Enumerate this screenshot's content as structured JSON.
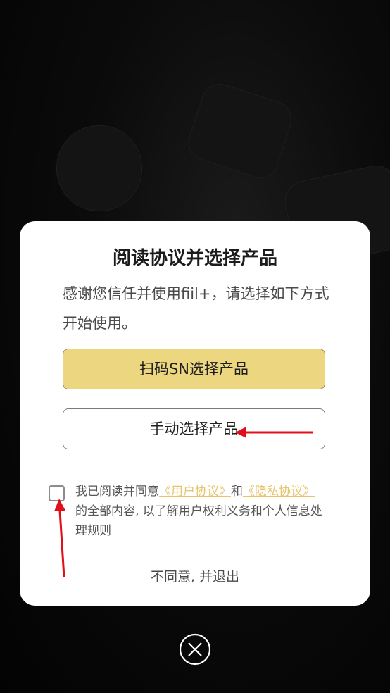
{
  "dialog": {
    "title": "阅读协议并选择产品",
    "description": "感谢您信任并使用fiil+，请选择如下方式开始使用。",
    "scan_button_label": "扫码SN选择产品",
    "manual_button_label": "手动选择产品",
    "agreement": {
      "prefix": "我已阅读并同意",
      "user_agreement_link": "《用户协议》",
      "conjunction": "和",
      "privacy_link": "《隐私协议》",
      "suffix": "的全部内容, 以了解用户权利义务和个人信息处理规则",
      "checked": false
    },
    "disagree_label": "不同意, 并退出"
  },
  "close_icon": "close-circle-icon",
  "annotation_color": "#e0101a",
  "accent_color": "#ecd67f",
  "link_color": "#e5c46b"
}
